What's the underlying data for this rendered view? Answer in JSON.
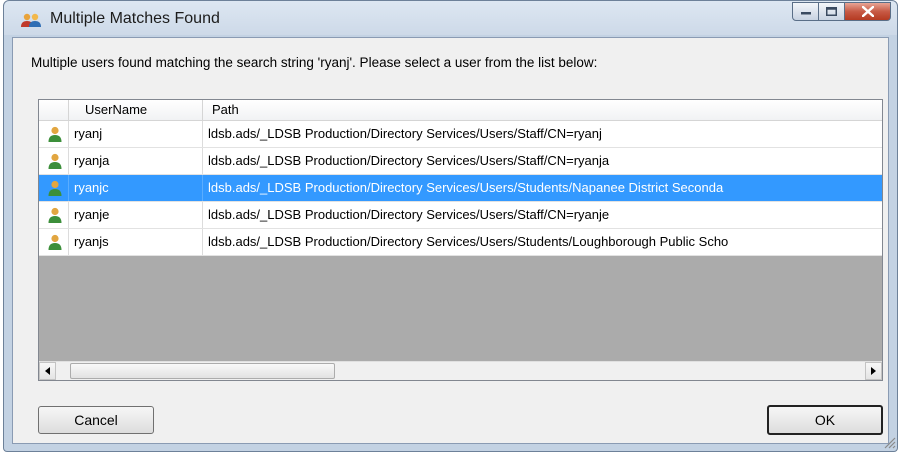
{
  "window": {
    "title": "Multiple Matches Found",
    "icon": "users-icon",
    "controls": [
      "minimize-icon",
      "maximize-icon",
      "close-icon"
    ]
  },
  "message": "Multiple users found matching the search string 'ryanj'.  Please select a user from the list below:",
  "list": {
    "columns": [
      "",
      "UserName",
      "Path"
    ],
    "rows": [
      {
        "icon": "user-icon",
        "username": "ryanj",
        "path": "ldsb.ads/_LDSB Production/Directory Services/Users/Staff/CN=ryanj",
        "selected": false
      },
      {
        "icon": "user-icon",
        "username": "ryanja",
        "path": "ldsb.ads/_LDSB Production/Directory Services/Users/Staff/CN=ryanja",
        "selected": false
      },
      {
        "icon": "user-icon",
        "username": "ryanjc",
        "path": "ldsb.ads/_LDSB Production/Directory Services/Users/Students/Napanee District Seconda",
        "selected": true
      },
      {
        "icon": "user-icon",
        "username": "ryanje",
        "path": "ldsb.ads/_LDSB Production/Directory Services/Users/Staff/CN=ryanje",
        "selected": false
      },
      {
        "icon": "user-icon",
        "username": "ryanjs",
        "path": "ldsb.ads/_LDSB Production/Directory Services/Users/Students/Loughborough Public Scho",
        "selected": false
      }
    ]
  },
  "buttons": {
    "cancel": "Cancel",
    "ok": "OK"
  },
  "colors": {
    "selection": "#3399ff",
    "list_empty_bg": "#ababab"
  }
}
